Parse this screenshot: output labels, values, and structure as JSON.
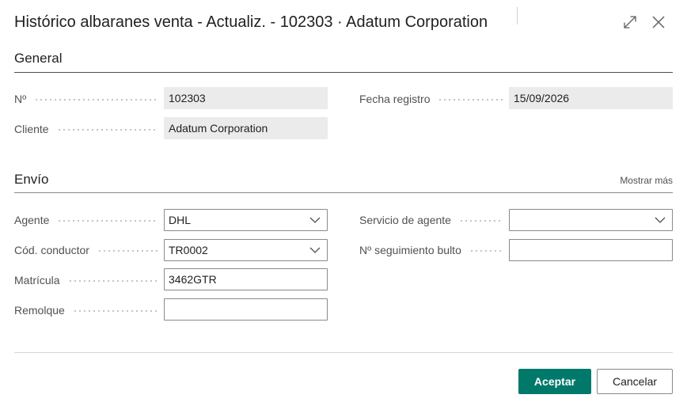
{
  "dialog": {
    "title": "Histórico albaranes venta - Actualiz. - 102303 · Adatum Corporation"
  },
  "sections": {
    "general": {
      "title": "General",
      "fields": {
        "no": {
          "label": "Nº",
          "value": "102303"
        },
        "customer": {
          "label": "Cliente",
          "value": "Adatum Corporation"
        },
        "posting_date": {
          "label": "Fecha registro",
          "value": "15/09/2026"
        }
      }
    },
    "shipping": {
      "title": "Envío",
      "show_more": "Mostrar más",
      "fields": {
        "agent": {
          "label": "Agente",
          "value": "DHL"
        },
        "driver_code": {
          "label": "Cód. conductor",
          "value": "TR0002"
        },
        "license_plate": {
          "label": "Matrícula",
          "value": "3462GTR"
        },
        "trailer": {
          "label": "Remolque",
          "value": ""
        },
        "agent_service": {
          "label": "Servicio de agente",
          "value": ""
        },
        "tracking_no": {
          "label": "Nº seguimiento bulto",
          "value": ""
        }
      }
    }
  },
  "buttons": {
    "ok": "Aceptar",
    "cancel": "Cancelar"
  },
  "icons": {
    "expand": "expand-icon",
    "close": "close-icon",
    "dropdown": "chevron-down-icon"
  },
  "colors": {
    "primary": "#00796b",
    "readonly_bg": "#ebebeb"
  }
}
